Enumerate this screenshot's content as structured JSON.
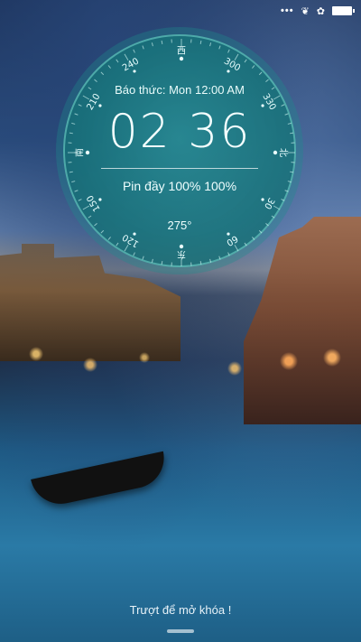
{
  "status_bar": {
    "icons": [
      "more-dots-icon",
      "leaf-icon",
      "flower-icon",
      "battery-icon"
    ]
  },
  "lockscreen": {
    "alarm": "Báo thức: Mon 12:00 AM",
    "time": "02 36",
    "battery": "Pin đầy 100% 100%",
    "heading": "275°",
    "compass_labels": [
      "西",
      "300",
      "330",
      "北",
      "30",
      "60",
      "东",
      "120",
      "150",
      "南",
      "210",
      "240"
    ],
    "unlock_hint": "Trượt để mở khóa !"
  }
}
